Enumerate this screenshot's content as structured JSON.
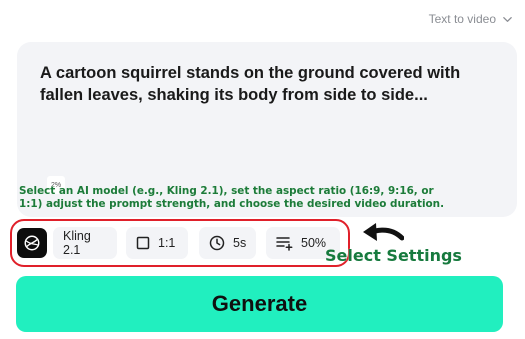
{
  "header": {
    "mode_label": "Text to video",
    "mode_icon": "chevron-down-icon"
  },
  "prompt": {
    "text": "A cartoon squirrel stands on the ground covered with fallen leaves, shaking its body from side to side...",
    "thumbnail_label": "2%"
  },
  "annotation": {
    "instructions": "Select an AI model (e.g., Kling 2.1), set the aspect ratio (16:9, 9:16, or 1:1) adjust the prompt strength, and choose the desired video duration.",
    "callout": "Select Settings",
    "color": "#1d7a3a"
  },
  "settings": {
    "model": {
      "label": "Kling 2.1",
      "icon": "kling-logo-icon"
    },
    "aspect_ratio": {
      "label": "1:1",
      "icon": "square-icon"
    },
    "duration": {
      "label": "5s",
      "icon": "clock-icon"
    },
    "strength": {
      "label": "50%",
      "icon": "list-plus-icon"
    }
  },
  "actions": {
    "generate_label": "Generate",
    "generate_color": "#21efbf"
  }
}
